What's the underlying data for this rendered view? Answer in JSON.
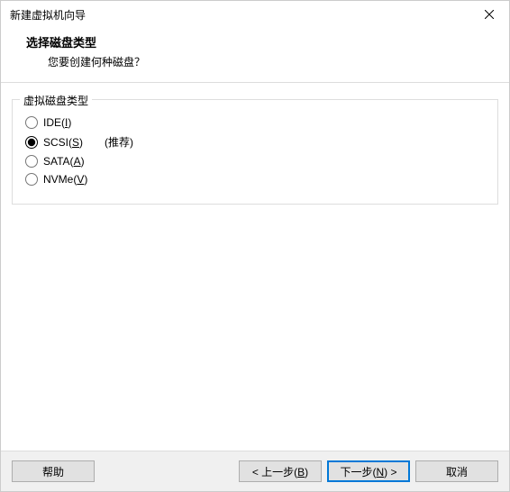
{
  "window": {
    "title": "新建虚拟机向导"
  },
  "header": {
    "title": "选择磁盘类型",
    "subtitle": "您要创建何种磁盘？"
  },
  "group": {
    "legend": "虚拟磁盘类型",
    "options": [
      {
        "label": "IDE(",
        "accel": "I",
        "label_after": ")",
        "recommended": ""
      },
      {
        "label": "SCSI(",
        "accel": "S",
        "label_after": ")",
        "recommended": "(推荐)"
      },
      {
        "label": "SATA(",
        "accel": "A",
        "label_after": ")",
        "recommended": ""
      },
      {
        "label": "NVMe(",
        "accel": "V",
        "label_after": ")",
        "recommended": ""
      }
    ],
    "selected_index": 1
  },
  "buttons": {
    "help": "帮助",
    "back_prefix": "< 上一步(",
    "back_accel": "B",
    "back_suffix": ")",
    "next_prefix": "下一步(",
    "next_accel": "N",
    "next_suffix": ") >",
    "cancel": "取消"
  }
}
